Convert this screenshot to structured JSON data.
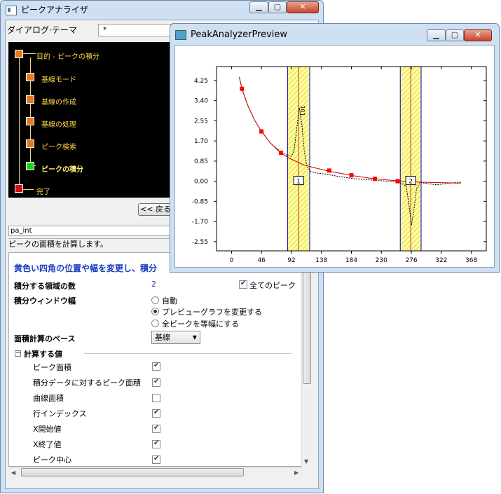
{
  "main_window": {
    "title": "ピークアナライザ",
    "dialog_theme_label": "ダイアログ·テーマ",
    "dialog_theme_value": "*",
    "flow_steps": [
      {
        "label": "目的 - ピークの積分",
        "state": "orange"
      },
      {
        "label": "基線モード",
        "state": "orange"
      },
      {
        "label": "基線の作成",
        "state": "orange"
      },
      {
        "label": "基線の処理",
        "state": "orange"
      },
      {
        "label": "ピーク検索",
        "state": "orange"
      },
      {
        "label": "ピークの積分",
        "state": "current"
      },
      {
        "label": "完了",
        "state": "end"
      }
    ],
    "back_button": "<< 戻る",
    "theme_name": "pa_int",
    "description": "ピークの面積を計算します。",
    "hint": "黄色い四角の位置や幅を変更し、積分",
    "fields": {
      "num_regions_label": "積分する領域の数",
      "num_regions_value": "2",
      "all_peaks_label": "全てのピーク",
      "all_peaks_checked": true,
      "window_width_label": "積分ウィンドウ幅",
      "window_options": [
        {
          "label": "自動",
          "selected": false
        },
        {
          "label": "プレビューグラフを変更する",
          "selected": true
        },
        {
          "label": "全ピークを等幅にする",
          "selected": false
        }
      ],
      "area_base_label": "面積計算のベース",
      "area_base_value": "基線"
    },
    "compute_section": {
      "title": "計算する値",
      "items": [
        {
          "label": "ピーク面積",
          "checked": true
        },
        {
          "label": "積分データに対するピーク面積",
          "checked": true
        },
        {
          "label": "曲線面積",
          "checked": false
        },
        {
          "label": "行インデックス",
          "checked": true
        },
        {
          "label": "X開始値",
          "checked": true
        },
        {
          "label": "X終了値",
          "checked": true
        },
        {
          "label": "ピーク中心",
          "checked": true
        }
      ]
    }
  },
  "preview_window": {
    "title": "PeakAnalyzerPreview"
  },
  "chart_data": {
    "type": "line",
    "x_ticks": [
      "0",
      "46",
      "92",
      "138",
      "184",
      "230",
      "276",
      "322",
      "368"
    ],
    "y_ticks": [
      "4.25",
      "3.40",
      "2.55",
      "1.70",
      "0.85",
      "0.00",
      "-0.85",
      "-1.70",
      "-2.55"
    ],
    "xlim": [
      -23,
      391
    ],
    "ylim": [
      -2.94,
      4.84
    ],
    "series": [
      {
        "x": [
          12,
          16,
          25,
          35,
          46,
          60,
          75,
          85,
          92,
          96,
          100,
          104,
          108,
          112,
          116,
          122,
          130,
          145,
          165,
          190,
          215,
          240,
          258,
          268,
          272,
          276,
          280,
          284,
          290,
          300,
          315,
          330,
          345,
          352
        ],
        "y": [
          4.4,
          3.9,
          3.2,
          2.6,
          2.1,
          1.6,
          1.25,
          1.1,
          1.05,
          1.3,
          2.2,
          3.1,
          2.4,
          1.2,
          0.6,
          0.4,
          0.35,
          0.3,
          0.2,
          0.1,
          0.05,
          0.0,
          -0.05,
          -0.2,
          -0.9,
          -1.85,
          -1.2,
          -0.3,
          -0.05,
          -0.1,
          -0.15,
          -0.1,
          -0.05,
          -0.05
        ],
        "color": "#000000",
        "dashed": true
      },
      {
        "x": [
          12,
          16,
          25,
          35,
          46,
          60,
          75,
          90,
          110,
          130,
          150,
          170,
          190,
          215,
          240,
          265,
          290,
          320,
          345,
          352
        ],
        "y": [
          4.4,
          3.9,
          3.2,
          2.6,
          2.1,
          1.6,
          1.2,
          0.95,
          0.7,
          0.55,
          0.42,
          0.32,
          0.22,
          0.12,
          0.05,
          0.0,
          -0.04,
          -0.06,
          -0.08,
          -0.08
        ],
        "color": "#cc0000",
        "dashed": false
      }
    ],
    "baseline_points": {
      "x": [
        16,
        46,
        76,
        150,
        184,
        220,
        255
      ],
      "y": [
        3.9,
        2.1,
        1.2,
        0.45,
        0.25,
        0.1,
        0.0
      ]
    },
    "regions": [
      {
        "label": "1",
        "x_start": 86,
        "x_end": 120,
        "center": 103
      },
      {
        "label": "2",
        "x_start": 259,
        "x_end": 291,
        "center": 275
      }
    ],
    "peak_label": "101"
  },
  "colors": {
    "region_fill": "#ffff99",
    "region_border": "#0000cc",
    "baseline_point": "#ff0000",
    "hint_text": "#1a3fc0"
  }
}
